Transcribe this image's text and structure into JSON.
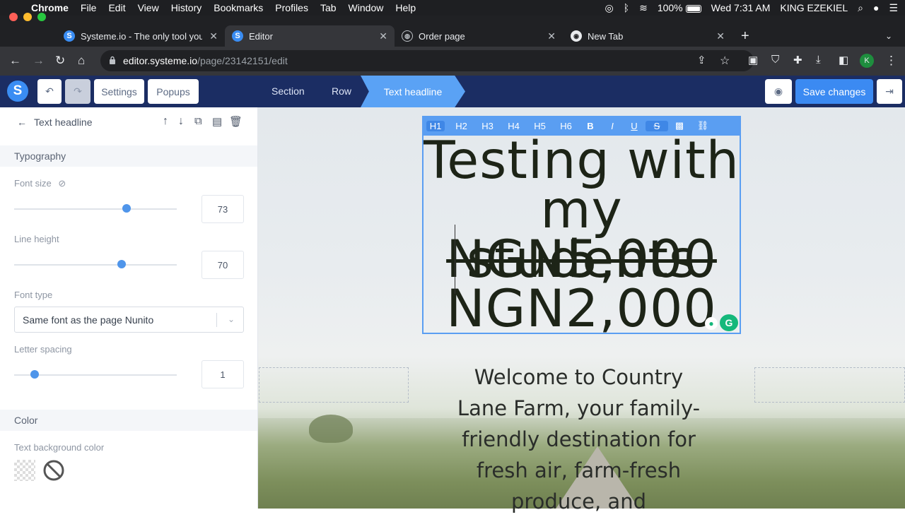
{
  "menubar": {
    "app": "Chrome",
    "items": [
      "File",
      "Edit",
      "View",
      "History",
      "Bookmarks",
      "Profiles",
      "Tab",
      "Window",
      "Help"
    ],
    "battery": "100%",
    "clock": "Wed 7:31 AM",
    "user": "KING EZEKIEL"
  },
  "tabs": [
    {
      "title": "Systeme.io - The only tool you",
      "icon": "S"
    },
    {
      "title": "Editor",
      "icon": "S"
    },
    {
      "title": "Order page",
      "icon": "globe"
    },
    {
      "title": "New Tab",
      "icon": "chrome"
    }
  ],
  "address": {
    "host": "editor.systeme.io",
    "path": "/page/23142151/edit"
  },
  "editor_bar": {
    "logo": "S",
    "settings": "Settings",
    "popups": "Popups",
    "crumbs": [
      "Section",
      "Row"
    ],
    "active_crumb": "Text headline",
    "save": "Save changes"
  },
  "sidebar": {
    "title": "Text headline",
    "typography": "Typography",
    "font_size_label": "Font size",
    "font_size_value": "73",
    "line_height_label": "Line height",
    "line_height_value": "70",
    "font_type_label": "Font type",
    "font_type_value": "Same font as the page Nunito",
    "letter_spacing_label": "Letter spacing",
    "letter_spacing_value": "1",
    "color_section": "Color",
    "text_bg_label": "Text background color"
  },
  "format_bar": [
    "H1",
    "H2",
    "H3",
    "H4",
    "H5",
    "H6",
    "B",
    "I",
    "U",
    "S"
  ],
  "headline": {
    "line1": "Testing with",
    "line2": "my students",
    "line3": "NGN5,000",
    "line4": "NGN2,000"
  },
  "body_text": "Welcome to Country Lane Farm, your family-friendly destination for fresh air, farm-fresh produce, and"
}
